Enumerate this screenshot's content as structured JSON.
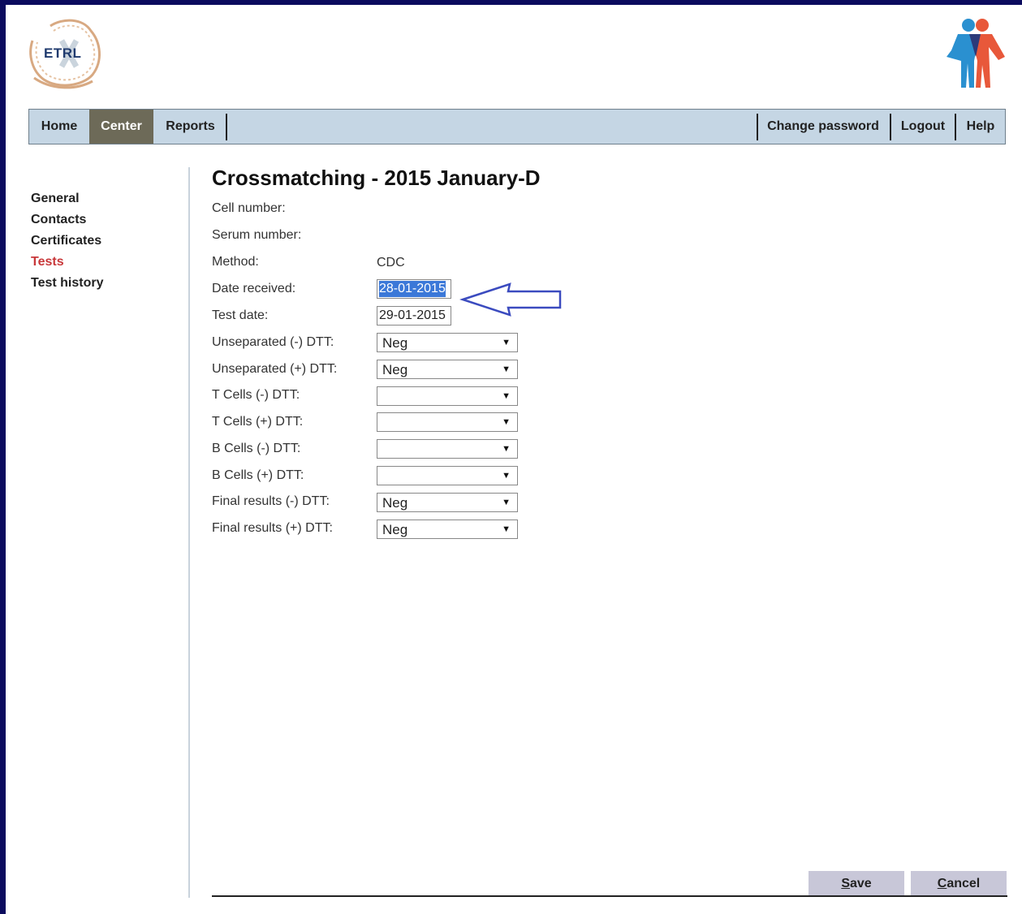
{
  "logo_left": {
    "text": "ETRL"
  },
  "nav": {
    "home": "Home",
    "center": "Center",
    "reports": "Reports",
    "change_password": "Change password",
    "logout": "Logout",
    "help": "Help"
  },
  "sidebar": {
    "items": [
      {
        "label": "General"
      },
      {
        "label": "Contacts"
      },
      {
        "label": "Certificates"
      },
      {
        "label": "Tests"
      },
      {
        "label": "Test history"
      }
    ]
  },
  "page": {
    "title": "Crossmatching - 2015 January-D"
  },
  "form": {
    "cell_number_label": "Cell number:",
    "serum_number_label": "Serum number:",
    "method_label": "Method:",
    "method_value": "CDC",
    "date_received_label": "Date received:",
    "date_received_value": "28-01-2015",
    "test_date_label": "Test date:",
    "test_date_value": "29-01-2015",
    "unsep_neg_label": "Unseparated (-) DTT:",
    "unsep_neg_value": "Neg",
    "unsep_pos_label": "Unseparated (+) DTT:",
    "unsep_pos_value": "Neg",
    "tcells_neg_label": "T Cells (-) DTT:",
    "tcells_neg_value": "",
    "tcells_pos_label": "T Cells (+) DTT:",
    "tcells_pos_value": "",
    "bcells_neg_label": "B Cells (-) DTT:",
    "bcells_neg_value": "",
    "bcells_pos_label": "B Cells (+) DTT:",
    "bcells_pos_value": "",
    "final_neg_label": "Final results (-) DTT:",
    "final_neg_value": "Neg",
    "final_pos_label": "Final results (+) DTT:",
    "final_pos_value": "Neg"
  },
  "buttons": {
    "save_first": "S",
    "save_rest": "ave",
    "cancel_first": "C",
    "cancel_rest": "ancel"
  },
  "colors": {
    "nav_bg": "#c5d6e4",
    "nav_active": "#6d6a58",
    "sidebar_active": "#c8383a",
    "frame": "#0b0b5e",
    "button_bg": "#c8c7d8",
    "annotation_arrow": "#3b4bbf"
  },
  "icons": {
    "left_logo": "etrl-dna-logo",
    "right_logo": "people-logo",
    "annotation": "left-arrow-icon",
    "dropdown": "caret-down-icon"
  }
}
